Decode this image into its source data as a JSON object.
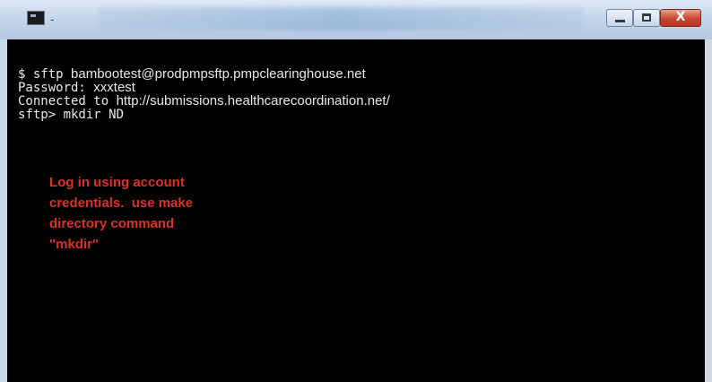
{
  "window": {
    "title_dash": "-",
    "buttons": {
      "minimize": "minimize",
      "maximize": "maximize",
      "close_label": "X"
    },
    "accent_close": "#c6452e"
  },
  "terminal": {
    "lines": [
      {
        "prefix": "$ sftp ",
        "rest": "bambootest@prodpmpsftp.pmpclearinghouse.net"
      },
      {
        "prefix": "Password: ",
        "rest": "xxxtest"
      },
      {
        "prefix": "Connected to ",
        "rest": "http://submissions.healthcarecoordination.net/"
      },
      {
        "prefix": "sftp> mkdir ND",
        "rest": ""
      }
    ],
    "background": "#000000",
    "text_color": "#e8e8e8"
  },
  "annotation": {
    "lines": [
      "Log in using account",
      "credentials.  use make",
      "directory command",
      "\"mkdir\""
    ],
    "color": "#d8322a"
  }
}
